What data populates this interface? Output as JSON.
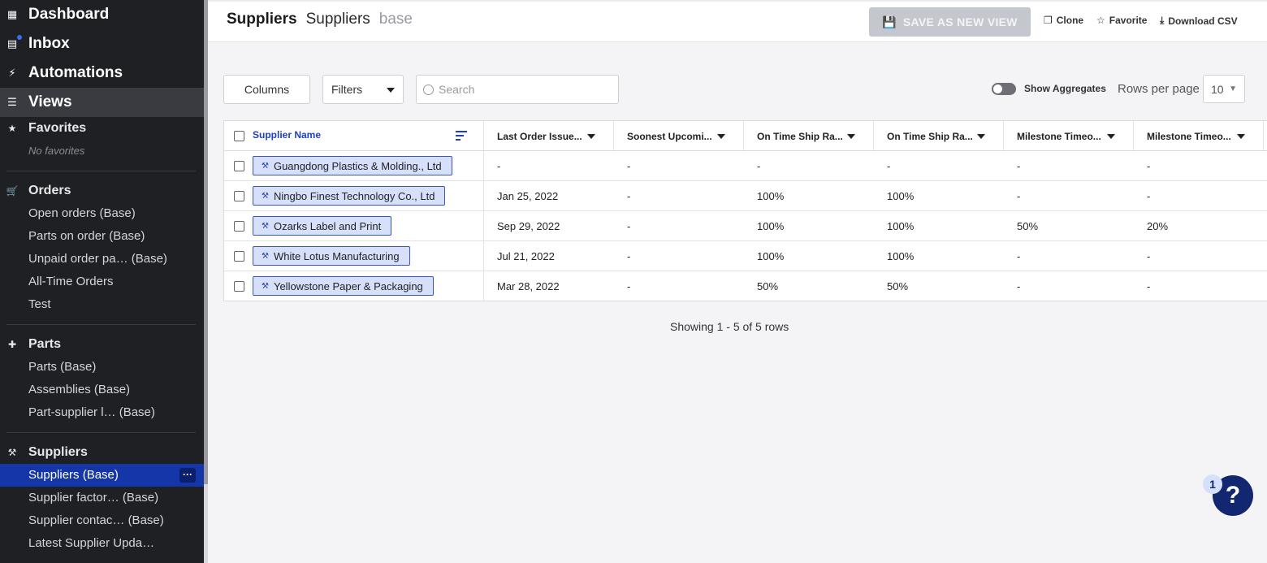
{
  "sidebar": {
    "top_items": [
      {
        "label": "Dashboard",
        "icon": "dashboard-icon"
      },
      {
        "label": "Inbox",
        "icon": "inbox-icon"
      },
      {
        "label": "Automations",
        "icon": "bolt-icon"
      },
      {
        "label": "Views",
        "icon": "list-icon"
      }
    ],
    "favorites": {
      "label": "Favorites",
      "empty": "No favorites"
    },
    "orders": {
      "label": "Orders",
      "items": [
        "Open orders (Base)",
        "Parts on order (Base)",
        "Unpaid order pa… (Base)",
        "All-Time Orders",
        "Test"
      ]
    },
    "parts": {
      "label": "Parts",
      "items": [
        "Parts (Base)",
        "Assemblies (Base)",
        "Part-supplier l… (Base)"
      ]
    },
    "suppliers": {
      "label": "Suppliers",
      "items": [
        "Suppliers (Base)",
        "Supplier factor… (Base)",
        "Supplier contac… (Base)",
        "Latest Supplier Upda…"
      ],
      "more": "···"
    }
  },
  "header": {
    "title_main": "Suppliers",
    "title_view": "Suppliers",
    "title_tag": "base",
    "save_label": "SAVE AS NEW VIEW",
    "clone_label": "Clone",
    "favorite_label": "Favorite",
    "download_label": "Download CSV"
  },
  "toolbar": {
    "columns_label": "Columns",
    "filters_label": "Filters",
    "search_placeholder": "Search",
    "aggregates_label": "Show Aggregates",
    "rows_per_page_label": "Rows per page",
    "rows_per_page_value": "10"
  },
  "table": {
    "columns": [
      "Supplier Name",
      "Last Order Issue...",
      "Soonest Upcomi...",
      "On Time Ship Ra...",
      "On Time Ship Ra...",
      "Milestone Timeo...",
      "Milestone Timeo..."
    ],
    "rows": [
      {
        "name": "Guangdong Plastics & Molding., Ltd",
        "cells": [
          "-",
          "-",
          "-",
          "-",
          "-",
          "-"
        ]
      },
      {
        "name": "Ningbo Finest Technology Co., Ltd",
        "cells": [
          "Jan 25, 2022",
          "-",
          "100%",
          "100%",
          "-",
          "-"
        ]
      },
      {
        "name": "Ozarks Label and Print",
        "cells": [
          "Sep 29, 2022",
          "-",
          "100%",
          "100%",
          "50%",
          "20%"
        ]
      },
      {
        "name": "White Lotus Manufacturing",
        "cells": [
          "Jul 21, 2022",
          "-",
          "100%",
          "100%",
          "-",
          "-"
        ]
      },
      {
        "name": "Yellowstone Paper & Packaging",
        "cells": [
          "Mar 28, 2022",
          "-",
          "50%",
          "50%",
          "-",
          "-"
        ]
      }
    ]
  },
  "footer": {
    "showing": "Showing 1 - 5 of 5 rows"
  },
  "help": {
    "badge": "1",
    "symbol": "?"
  },
  "colors": {
    "sidebar_bg": "#1f2024",
    "active": "#1436a8",
    "chip_bg": "#d7e0fb",
    "help_bg": "#132770"
  }
}
